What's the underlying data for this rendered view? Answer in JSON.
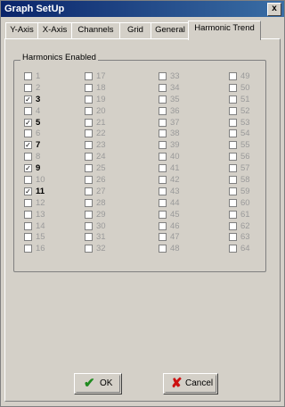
{
  "window": {
    "title": "Graph SetUp",
    "close_glyph": "x"
  },
  "tabs": [
    {
      "label": "Y-Axis",
      "active": false
    },
    {
      "label": "X-Axis",
      "active": false
    },
    {
      "label": "Channels",
      "active": false
    },
    {
      "label": "Grid",
      "active": false
    },
    {
      "label": "General",
      "active": false
    },
    {
      "label": "Harmonic Trend",
      "active": true
    }
  ],
  "harmonics": {
    "group_label": "Harmonics Enabled",
    "items": [
      {
        "label": "1",
        "checked": false
      },
      {
        "label": "2",
        "checked": false
      },
      {
        "label": "3",
        "checked": true
      },
      {
        "label": "4",
        "checked": false
      },
      {
        "label": "5",
        "checked": true
      },
      {
        "label": "6",
        "checked": false
      },
      {
        "label": "7",
        "checked": true
      },
      {
        "label": "8",
        "checked": false
      },
      {
        "label": "9",
        "checked": true
      },
      {
        "label": "10",
        "checked": false
      },
      {
        "label": "11",
        "checked": true
      },
      {
        "label": "12",
        "checked": false
      },
      {
        "label": "13",
        "checked": false
      },
      {
        "label": "14",
        "checked": false
      },
      {
        "label": "15",
        "checked": false
      },
      {
        "label": "16",
        "checked": false
      },
      {
        "label": "17",
        "checked": false
      },
      {
        "label": "18",
        "checked": false
      },
      {
        "label": "19",
        "checked": false
      },
      {
        "label": "20",
        "checked": false
      },
      {
        "label": "21",
        "checked": false
      },
      {
        "label": "22",
        "checked": false
      },
      {
        "label": "23",
        "checked": false
      },
      {
        "label": "24",
        "checked": false
      },
      {
        "label": "25",
        "checked": false
      },
      {
        "label": "26",
        "checked": false
      },
      {
        "label": "27",
        "checked": false
      },
      {
        "label": "28",
        "checked": false
      },
      {
        "label": "29",
        "checked": false
      },
      {
        "label": "30",
        "checked": false
      },
      {
        "label": "31",
        "checked": false
      },
      {
        "label": "32",
        "checked": false
      },
      {
        "label": "33",
        "checked": false
      },
      {
        "label": "34",
        "checked": false
      },
      {
        "label": "35",
        "checked": false
      },
      {
        "label": "36",
        "checked": false
      },
      {
        "label": "37",
        "checked": false
      },
      {
        "label": "38",
        "checked": false
      },
      {
        "label": "39",
        "checked": false
      },
      {
        "label": "40",
        "checked": false
      },
      {
        "label": "41",
        "checked": false
      },
      {
        "label": "42",
        "checked": false
      },
      {
        "label": "43",
        "checked": false
      },
      {
        "label": "44",
        "checked": false
      },
      {
        "label": "45",
        "checked": false
      },
      {
        "label": "46",
        "checked": false
      },
      {
        "label": "47",
        "checked": false
      },
      {
        "label": "48",
        "checked": false
      },
      {
        "label": "49",
        "checked": false
      },
      {
        "label": "50",
        "checked": false
      },
      {
        "label": "51",
        "checked": false
      },
      {
        "label": "52",
        "checked": false
      },
      {
        "label": "53",
        "checked": false
      },
      {
        "label": "54",
        "checked": false
      },
      {
        "label": "55",
        "checked": false
      },
      {
        "label": "56",
        "checked": false
      },
      {
        "label": "57",
        "checked": false
      },
      {
        "label": "58",
        "checked": false
      },
      {
        "label": "59",
        "checked": false
      },
      {
        "label": "60",
        "checked": false
      },
      {
        "label": "61",
        "checked": false
      },
      {
        "label": "62",
        "checked": false
      },
      {
        "label": "63",
        "checked": false
      },
      {
        "label": "64",
        "checked": false
      }
    ]
  },
  "buttons": {
    "ok": {
      "label": "OK",
      "icon": "checkmark-icon",
      "color": "#1f8a1f"
    },
    "cancel": {
      "label": "Cancel",
      "icon": "x-icon",
      "color": "#cc1111"
    }
  },
  "colors": {
    "face": "#d4d0c8",
    "title_start": "#0a246a",
    "title_end": "#3a6ea5",
    "disabled_text": "#9a9a9a"
  }
}
